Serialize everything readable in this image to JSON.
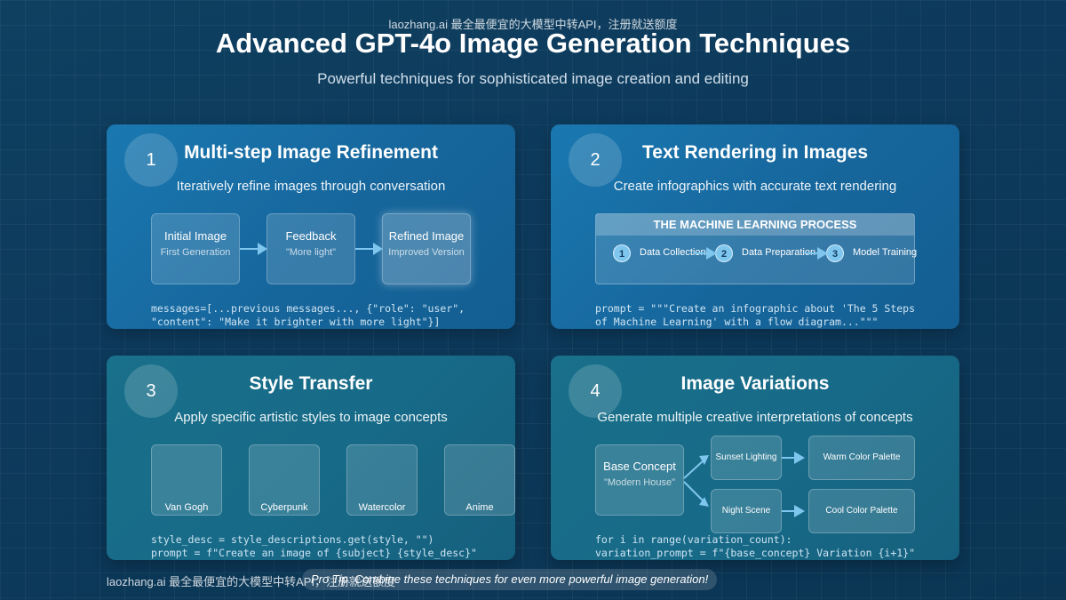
{
  "watermark": "laozhang.ai 最全最便宜的大模型中转API，注册就送额度",
  "title": "Advanced GPT-4o Image Generation Techniques",
  "subtitle": "Powerful techniques for sophisticated image creation and editing",
  "colors": {
    "background": "#0d3a5c",
    "card_blue": "#16669c",
    "card_teal": "#176a88",
    "accent": "#7fc6ef"
  },
  "cards": [
    {
      "number": "1",
      "title": "Multi-step Image Refinement",
      "description": "Iteratively refine images through conversation",
      "flow": [
        {
          "title": "Initial Image",
          "subtitle": "First Generation"
        },
        {
          "title": "Feedback",
          "subtitle": "\"More light\""
        },
        {
          "title": "Refined Image",
          "subtitle": "Improved Version"
        }
      ],
      "code": [
        "messages=[...previous messages..., {\"role\": \"user\",",
        "\"content\": \"Make it brighter with more light\"}]"
      ]
    },
    {
      "number": "2",
      "title": "Text Rendering in Images",
      "description": "Create infographics with accurate text rendering",
      "infographic": {
        "header": "THE MACHINE LEARNING PROCESS",
        "steps": [
          {
            "num": "1",
            "label": "Data Collection"
          },
          {
            "num": "2",
            "label": "Data Preparation"
          },
          {
            "num": "3",
            "label": "Model Training"
          }
        ]
      },
      "code": [
        "prompt = \"\"\"Create an infographic about 'The 5 Steps",
        "of Machine Learning' with a flow diagram...\"\"\""
      ]
    },
    {
      "number": "3",
      "title": "Style Transfer",
      "description": "Apply specific artistic styles to image concepts",
      "styles": [
        "Van Gogh",
        "Cyberpunk",
        "Watercolor",
        "Anime"
      ],
      "code": [
        "style_desc = style_descriptions.get(style, \"\")",
        "prompt = f\"Create an image of {subject} {style_desc}\""
      ]
    },
    {
      "number": "4",
      "title": "Image Variations",
      "description": "Generate multiple creative interpretations of concepts",
      "base": {
        "title": "Base Concept",
        "subtitle": "\"Modern House\""
      },
      "variations": [
        "Sunset Lighting",
        "Night Scene"
      ],
      "palettes": [
        "Warm Color Palette",
        "Cool Color Palette"
      ],
      "code": [
        "for i in range(variation_count):",
        "variation_prompt = f\"{base_concept} Variation {i+1}\""
      ]
    }
  ],
  "footer": {
    "watermark": "laozhang.ai 最全最便宜的大模型中转API，注册就送额度",
    "tip": "Pro Tip: Combine these techniques for even more powerful image generation!"
  }
}
